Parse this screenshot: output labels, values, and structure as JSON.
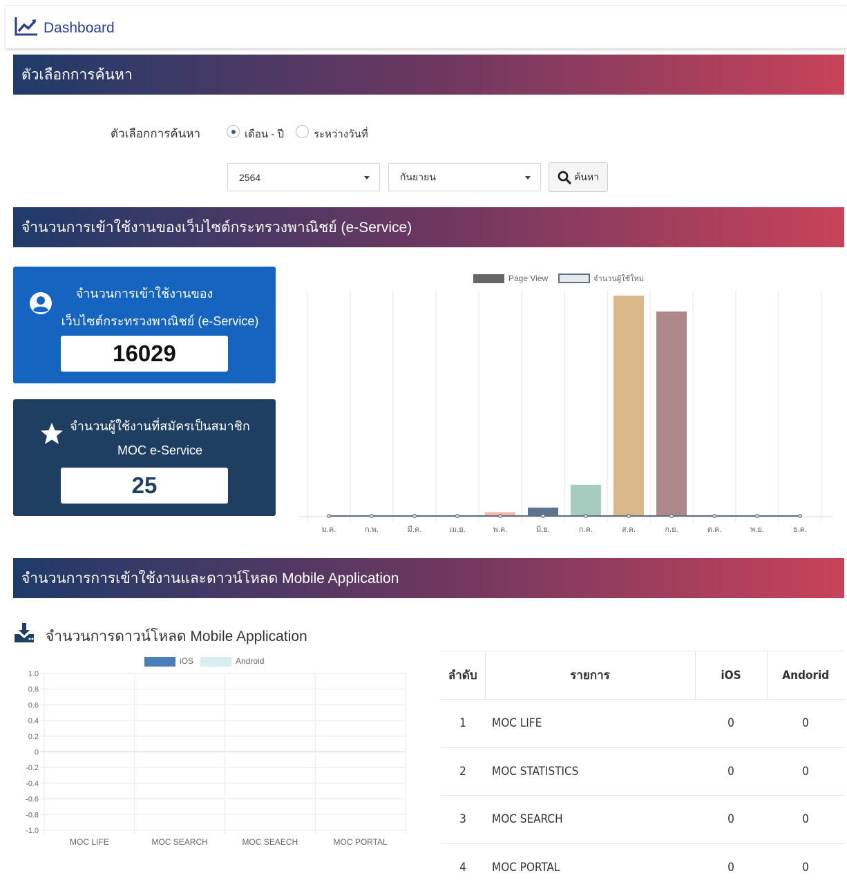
{
  "header": {
    "title": "Dashboard",
    "icon": "line-chart-icon"
  },
  "search_section": {
    "title": "ตัวเลือกการค้นหา",
    "label": "ตัวเลือกการค้นหา",
    "radio_month_year": "เดือน - ปี",
    "radio_date_range": "ระหว่างวันที่",
    "selected_radio": "เดือน - ปี",
    "year_value": "2564",
    "month_value": "กันยายน",
    "search_button": "ค้นหา"
  },
  "web_section": {
    "title": "จำนวนการเข้าใช้งานของเว็บไซต์กระทรวงพาณิชย์ (e-Service)",
    "card1": {
      "line1": "จำนวนการเข้าใช้งานของ",
      "line2": "เว็บไซต์กระทรวงพาณิชย์ (e-Service)",
      "value": "16029",
      "color": "#1565c0"
    },
    "card2": {
      "line1": "จำนวนผู้ใช้งานที่สมัครเป็นสมาชิก",
      "line2": "MOC e-Service",
      "value": "25",
      "color": "#1e3f61"
    }
  },
  "mobile_section": {
    "title": "จำนวนการการเข้าใช้งานและดาวน์โหลด Mobile Application",
    "download_title": "จำนวนการดาวน์โหลด Mobile Application",
    "table": {
      "headers": [
        "ลำดับ",
        "รายการ",
        "iOS",
        "Andorid"
      ],
      "rows": [
        [
          "1",
          "MOC LIFE",
          "0",
          "0"
        ],
        [
          "2",
          "MOC STATISTICS",
          "0",
          "0"
        ],
        [
          "3",
          "MOC SEARCH",
          "0",
          "0"
        ],
        [
          "4",
          "MOC PORTAL",
          "0",
          "0"
        ]
      ]
    }
  },
  "chart_data": [
    {
      "type": "bar",
      "categories": [
        "ม.ค.",
        "ก.พ.",
        "มี.ค.",
        "เม.ย.",
        "พ.ค.",
        "มิ.ย.",
        "ก.ค.",
        "ส.ค.",
        "ก.ย.",
        "ต.ค.",
        "พ.ย.",
        "ธ.ค."
      ],
      "series": [
        {
          "name": "Page View",
          "type": "bar",
          "values": [
            0,
            0,
            0,
            0,
            200,
            400,
            1400,
            9700,
            9000,
            0,
            0,
            0
          ],
          "colors": [
            "#cccccc",
            "#cccccc",
            "#cccccc",
            "#cccccc",
            "#f4b9a6",
            "#5b7590",
            "#a6cbbf",
            "#d9b98a",
            "#ae8888",
            "#cccccc",
            "#cccccc",
            "#cccccc"
          ]
        },
        {
          "name": "จำนวนผู้ใช้ใหม่",
          "type": "line",
          "values": [
            0,
            0,
            0,
            0,
            0,
            0,
            0,
            0,
            0,
            0,
            0,
            0
          ],
          "color": "#5f6f82"
        }
      ],
      "ylim": [
        0,
        10000
      ],
      "legend": "top",
      "grid": "vertical"
    },
    {
      "type": "bar",
      "categories": [
        "MOC LIFE",
        "MOC SEARCH",
        "MOC SEAECH",
        "MOC PORTAL"
      ],
      "series": [
        {
          "name": "iOS",
          "values": [
            0,
            0,
            0,
            0
          ],
          "color": "#4a7fba"
        },
        {
          "name": "Android",
          "values": [
            0,
            0,
            0,
            0
          ],
          "color": "#d8eef2"
        }
      ],
      "ylim": [
        -1.0,
        1.0
      ],
      "yticks": [
        "1.0",
        "0.8",
        "0.6",
        "0.4",
        "0.2",
        "0",
        "-0.2",
        "-0.4",
        "-0.6",
        "-0.8",
        "-1.0"
      ],
      "legend": "top",
      "grid": "both"
    }
  ]
}
